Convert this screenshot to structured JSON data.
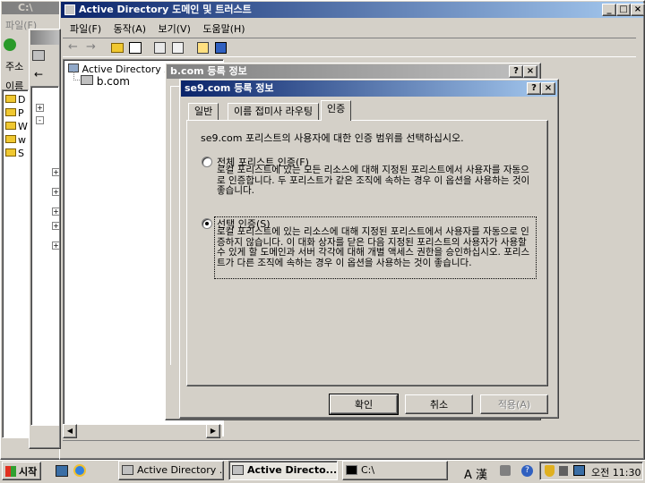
{
  "bg_window": {
    "title": "C:\\",
    "menu_items": [
      "파일(F)"
    ],
    "label_addr": "주소",
    "label_name": "이름",
    "labels": [
      "D",
      "P",
      "W",
      "w",
      "S"
    ]
  },
  "mmc": {
    "title": "Active Directory 도메인 및 트러스트",
    "menu": [
      "파일(F)",
      "동작(A)",
      "보기(V)",
      "도움말(H)"
    ],
    "tree_root": "Active Directory 도",
    "tree_child": "b.com"
  },
  "props_b": {
    "title": "b.com 등록 정보",
    "help": "?",
    "close": "×"
  },
  "dialog": {
    "title": "se9.com 등록 정보",
    "help": "?",
    "close": "×",
    "tabs": [
      "일반",
      "이름 접미사 라우팅",
      "인증"
    ],
    "intro": "se9.com 포리스트의 사용자에 대한 인증 범위를 선택하십시오.",
    "option1_label": "전체 포리스트 인증(F)",
    "option1_desc": "로컬 포리스트에 있는 모든 리소스에 대해 지정된 포리스트에서 사용자를 자동으로 인증합니다. 두 포리스트가 같은 조직에 속하는 경우 이 옵션을 사용하는 것이 좋습니다.",
    "option2_label": "선택 인증(S)",
    "option2_desc": "로컬 포리스트에 있는 리소스에 대해 지정된 포리스트에서 사용자를 자동으로 인증하지 않습니다. 이 대화 상자를 닫은 다음 지정된 포리스트의 사용자가 사용할 수 있게 할 도메인과 서버 각각에 대해 개별 액세스 권한을 승인하십시오. 포리스트가 다른 조직에 속하는 경우 이 옵션을 사용하는 것이 좋습니다.",
    "selected": 2,
    "btn_ok": "확인",
    "btn_cancel": "취소",
    "btn_apply": "적용(A)"
  },
  "taskbar": {
    "start": "시작",
    "tasks": [
      "Active Directory ...",
      "Active Directo...",
      "C:\\"
    ],
    "active_task": 1,
    "tray_lang": "A 漢",
    "time": "오전 11:30"
  }
}
